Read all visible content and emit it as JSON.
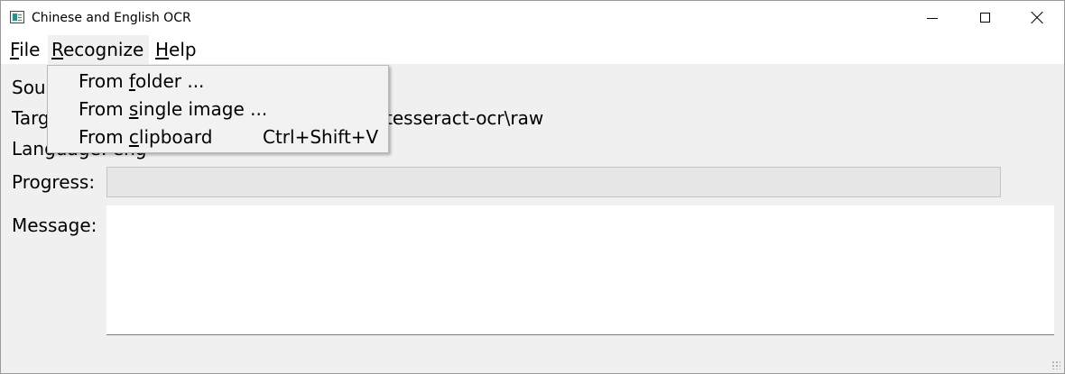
{
  "window": {
    "title": "Chinese and English OCR",
    "icon": "app-icon",
    "controls": {
      "minimize_icon": "minimize-icon",
      "maximize_icon": "maximize-icon",
      "close_icon": "close-icon"
    }
  },
  "menubar": {
    "file": {
      "mnemonic": "F",
      "rest": "ile"
    },
    "recognize": {
      "mnemonic": "R",
      "rest": "ecognize"
    },
    "help": {
      "mnemonic": "H",
      "rest": "elp"
    }
  },
  "recognize_menu": {
    "items": [
      {
        "pre": "From ",
        "mnemonic": "f",
        "post": "older ...",
        "shortcut": ""
      },
      {
        "pre": "From ",
        "mnemonic": "s",
        "post": "ingle image ...",
        "shortcut": ""
      },
      {
        "pre": "From ",
        "mnemonic": "c",
        "post": "lipboard",
        "shortcut": "Ctrl+Shift+V"
      }
    ]
  },
  "form": {
    "source_label_visible": "Sou",
    "target_label_visible": "Targ",
    "target_value_visible": "tesseract-ocr\\raw",
    "language_label_visible": "Language: eng",
    "progress_label": "Progress:",
    "message_label": "Message:"
  },
  "progress": {
    "value_fraction": 0
  },
  "message": {
    "text": ""
  },
  "colors": {
    "background": "#f0f0f0",
    "titlebar": "#ffffff",
    "menubar": "#ffffff",
    "progress_track": "#e6e6e6",
    "progress_fill": "#06b025",
    "menu_background": "#f2f2f2"
  }
}
